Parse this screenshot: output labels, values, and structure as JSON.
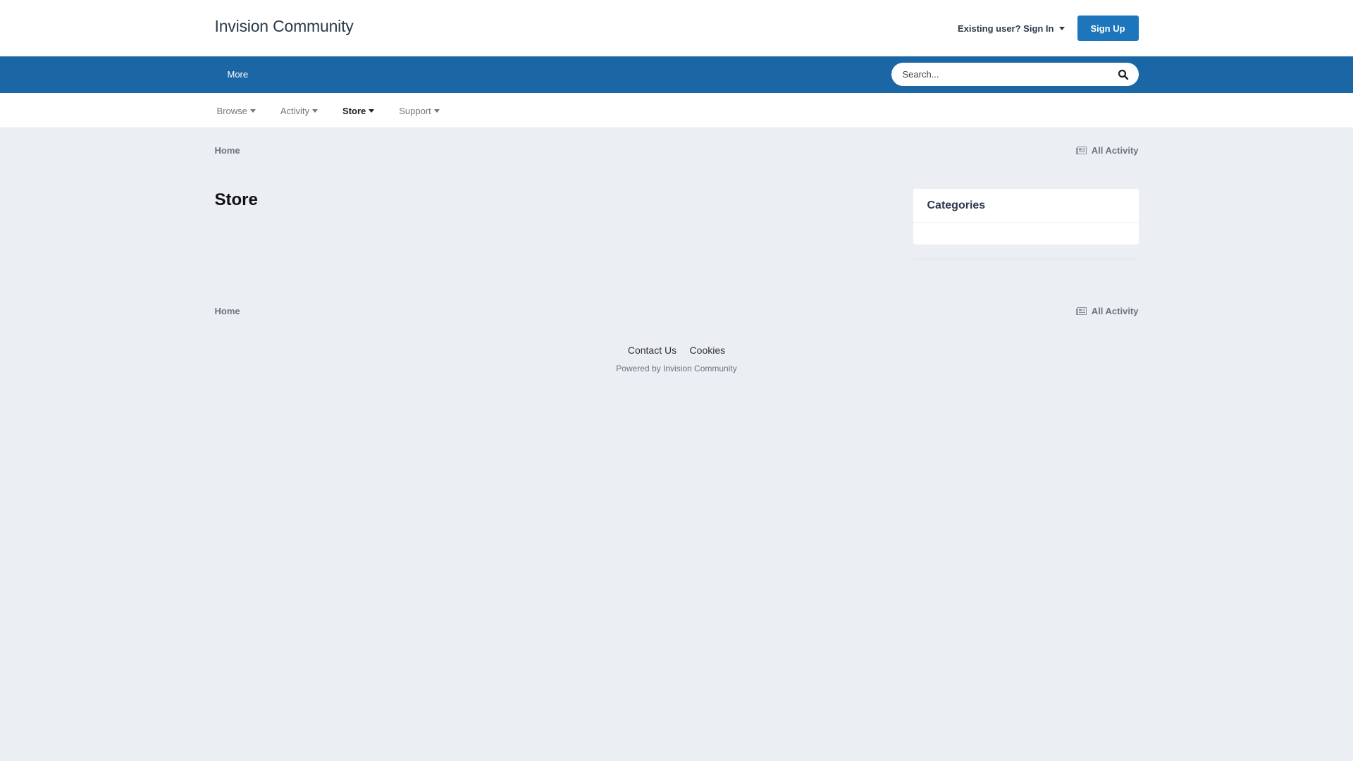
{
  "header": {
    "logo": "Invision Community",
    "signin_label": "Existing user? Sign In",
    "signup_label": "Sign Up"
  },
  "nav": {
    "more_label": "More",
    "search_placeholder": "Search..."
  },
  "subnav": {
    "items": [
      {
        "label": "Browse"
      },
      {
        "label": "Activity"
      },
      {
        "label": "Store"
      },
      {
        "label": "Support"
      }
    ]
  },
  "breadcrumb": {
    "home": "Home",
    "all_activity": "All Activity"
  },
  "page": {
    "title": "Store"
  },
  "sidebar": {
    "categories_title": "Categories"
  },
  "footer": {
    "links": [
      "Contact Us",
      "Cookies"
    ],
    "powered": "Powered by Invision Community"
  },
  "colors": {
    "brand_blue": "#1b67a6",
    "button_blue": "#1d76bb",
    "page_bg": "#ebeef2"
  }
}
